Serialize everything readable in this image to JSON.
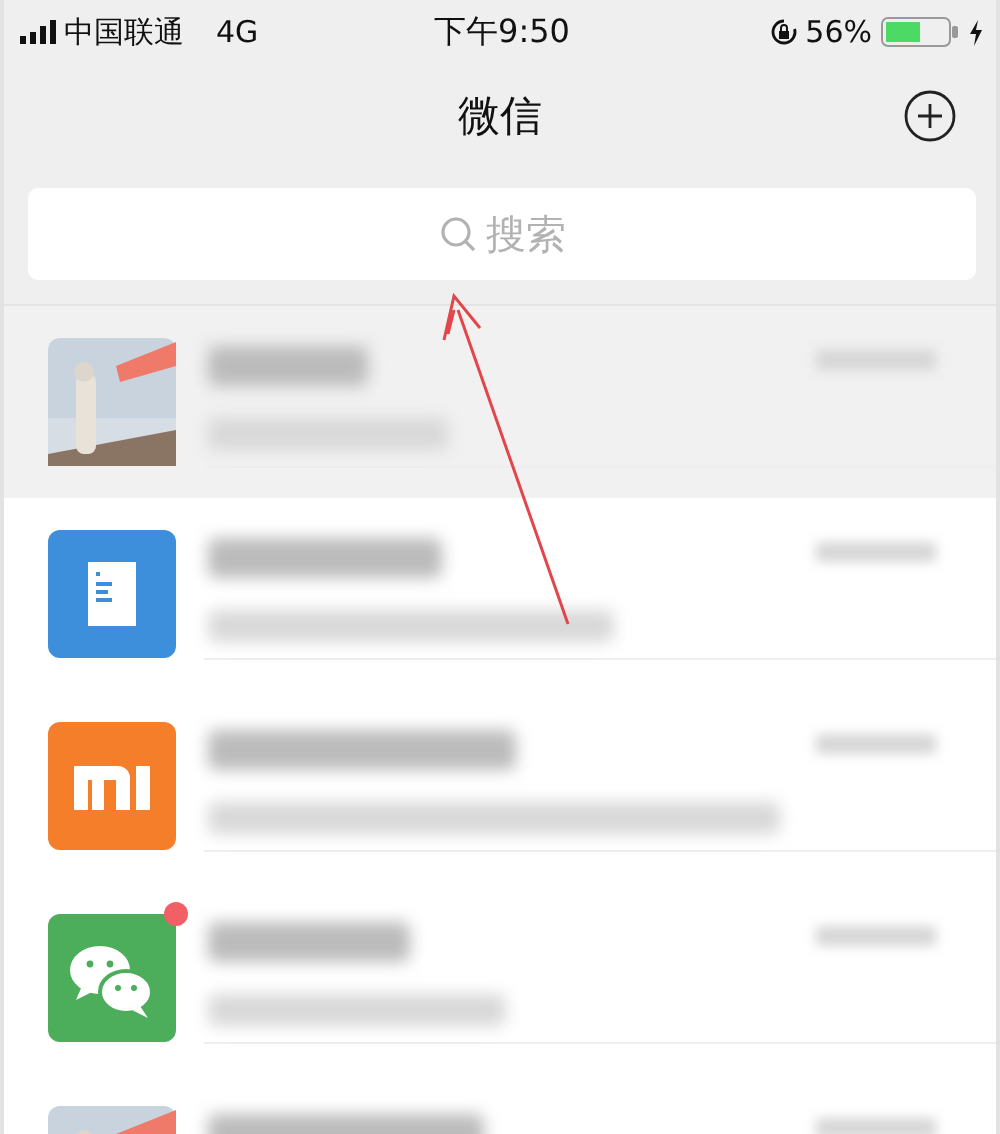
{
  "status_bar": {
    "carrier": "中国联通",
    "network": "4G",
    "time": "下午9:50",
    "battery": "56%"
  },
  "nav": {
    "title": "微信"
  },
  "search": {
    "placeholder": "搜索"
  },
  "chats": [
    {
      "pinned": true,
      "unread": false
    },
    {
      "avatar": {
        "kind": "document"
      },
      "pinned": false,
      "unread": false
    },
    {
      "avatar": {
        "kind": "mi"
      },
      "pinned": false,
      "unread": false
    },
    {
      "avatar": {
        "kind": "wechat"
      },
      "pinned": false,
      "unread": true
    },
    {
      "pinned": false,
      "unread": false
    }
  ]
}
